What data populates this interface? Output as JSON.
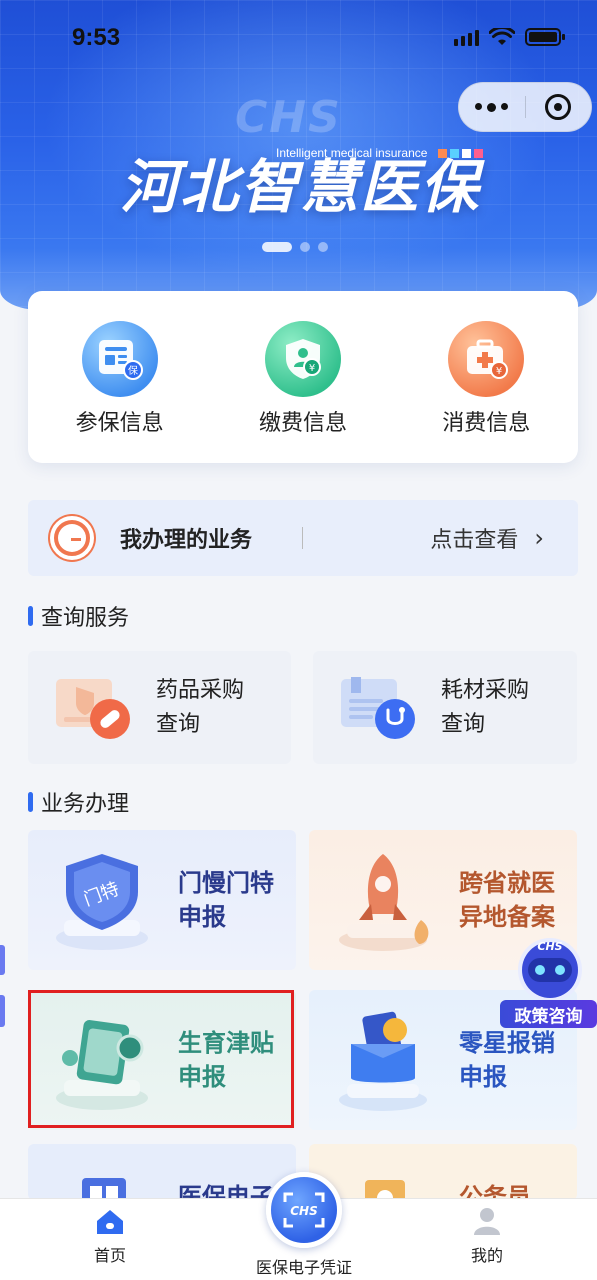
{
  "status_bar": {
    "time": "9:53"
  },
  "banner": {
    "title": "河北智慧医保",
    "subtitle": "Intelligent medical insurance",
    "watermark": "CHS"
  },
  "info_card": {
    "items": [
      {
        "label": "参保信息",
        "icon": "insurance-doc-icon"
      },
      {
        "label": "缴费信息",
        "icon": "payment-shield-icon"
      },
      {
        "label": "消费信息",
        "icon": "consumption-medkit-icon"
      }
    ]
  },
  "business_bar": {
    "title": "我办理的业务",
    "link": "点击查看",
    "chevron": "›"
  },
  "query_section": {
    "title": "查询服务",
    "cards": [
      {
        "line1": "药品采购",
        "line2": "查询"
      },
      {
        "line1": "耗材采购",
        "line2": "查询"
      }
    ]
  },
  "business_section": {
    "title": "业务办理",
    "cards": [
      {
        "line1": "门慢门特",
        "line2": "申报"
      },
      {
        "line1": "跨省就医",
        "line2": "异地备案"
      },
      {
        "line1": "生育津贴",
        "line2": "申报"
      },
      {
        "line1": "零星报销",
        "line2": "申报"
      },
      {
        "line1": "医保电子",
        "line2": ""
      },
      {
        "line1": "公务员",
        "line2": ""
      }
    ]
  },
  "floating_robot": {
    "label": "政策咨询",
    "badge": "CHS"
  },
  "tabbar": {
    "home": "首页",
    "center": "医保电子凭证",
    "center_badge": "CHS",
    "mine": "我的"
  },
  "colors": {
    "primary": "#2f6bf0",
    "banner_blue": "#2a62e8",
    "selection_red": "#e02020"
  }
}
